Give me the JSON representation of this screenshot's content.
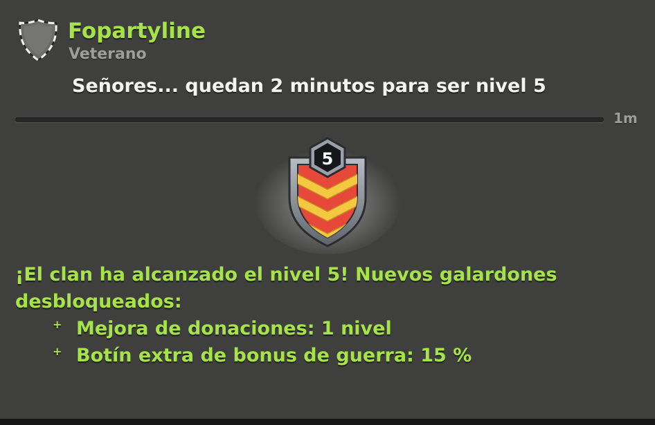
{
  "post": {
    "author": "Fopartyline",
    "role": "Veterano",
    "message": "Señores... quedan 2 minutos para ser nivel 5",
    "time": "1m"
  },
  "clan_badge": {
    "level": "5",
    "icon": "clan-level-shield-icon",
    "colors": {
      "shield": "#e6483a",
      "chevrons": "#f5c842",
      "frame": "#8a8f96"
    }
  },
  "announcement": {
    "text": "¡El clan ha alcanzado el nivel  5! Nuevos galardones desbloqueados:",
    "rewards": [
      {
        "bullet": "+",
        "text": "Mejora de donaciones: 1  nivel"
      },
      {
        "bullet": "+",
        "text": "Botín extra de bonus de guerra: 15  %"
      }
    ]
  },
  "colors": {
    "background": "#3f3f3d",
    "author": "#a6e34a",
    "message": "#f3f3f1",
    "muted": "#9d9d99"
  }
}
